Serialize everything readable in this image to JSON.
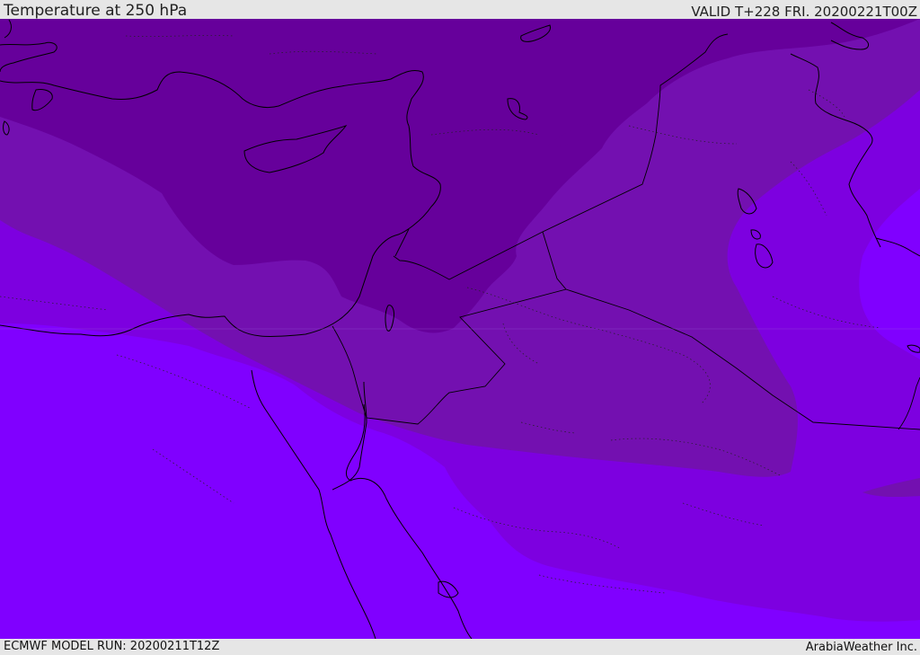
{
  "header": {
    "title": "Temperature at 250 hPa",
    "valid": "VALID T+228 FRI. 20200221T00Z"
  },
  "footer": {
    "model_run": "ECMWF MODEL RUN: 20200211T12Z",
    "credit": "ArabiaWeather Inc."
  },
  "map": {
    "colors": {
      "band_darkest": "#66009b",
      "band_dark": "#7310b0",
      "band_mid": "#7d00e0",
      "band_light": "#8000ff",
      "coastline": "#000000"
    }
  }
}
